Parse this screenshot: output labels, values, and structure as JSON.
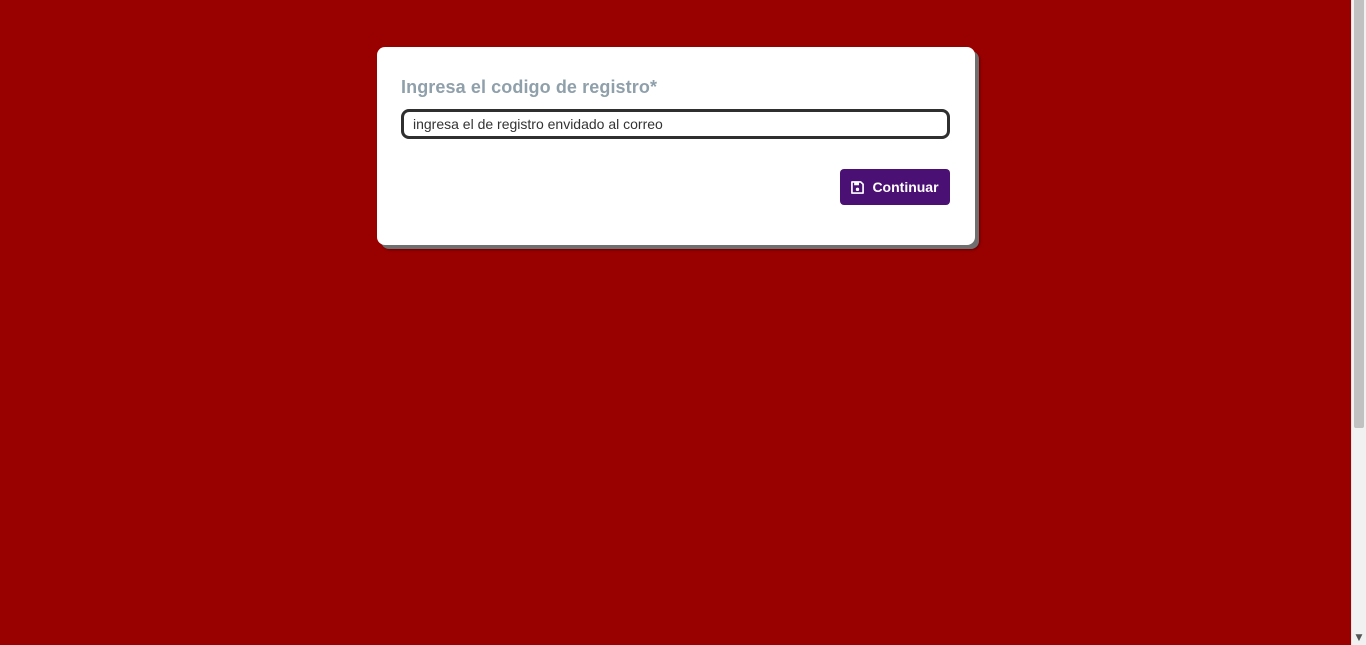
{
  "page": {
    "background_color": "#990000"
  },
  "form": {
    "label": "Ingresa el codigo de registro*",
    "code_input": {
      "value": "",
      "placeholder": "ingresa el de registro envidado al correo"
    },
    "continue_button": {
      "label": "Continuar",
      "icon": "save-icon",
      "color": "#4b1073"
    }
  },
  "scrollbar": {
    "down_arrow": "▼"
  }
}
